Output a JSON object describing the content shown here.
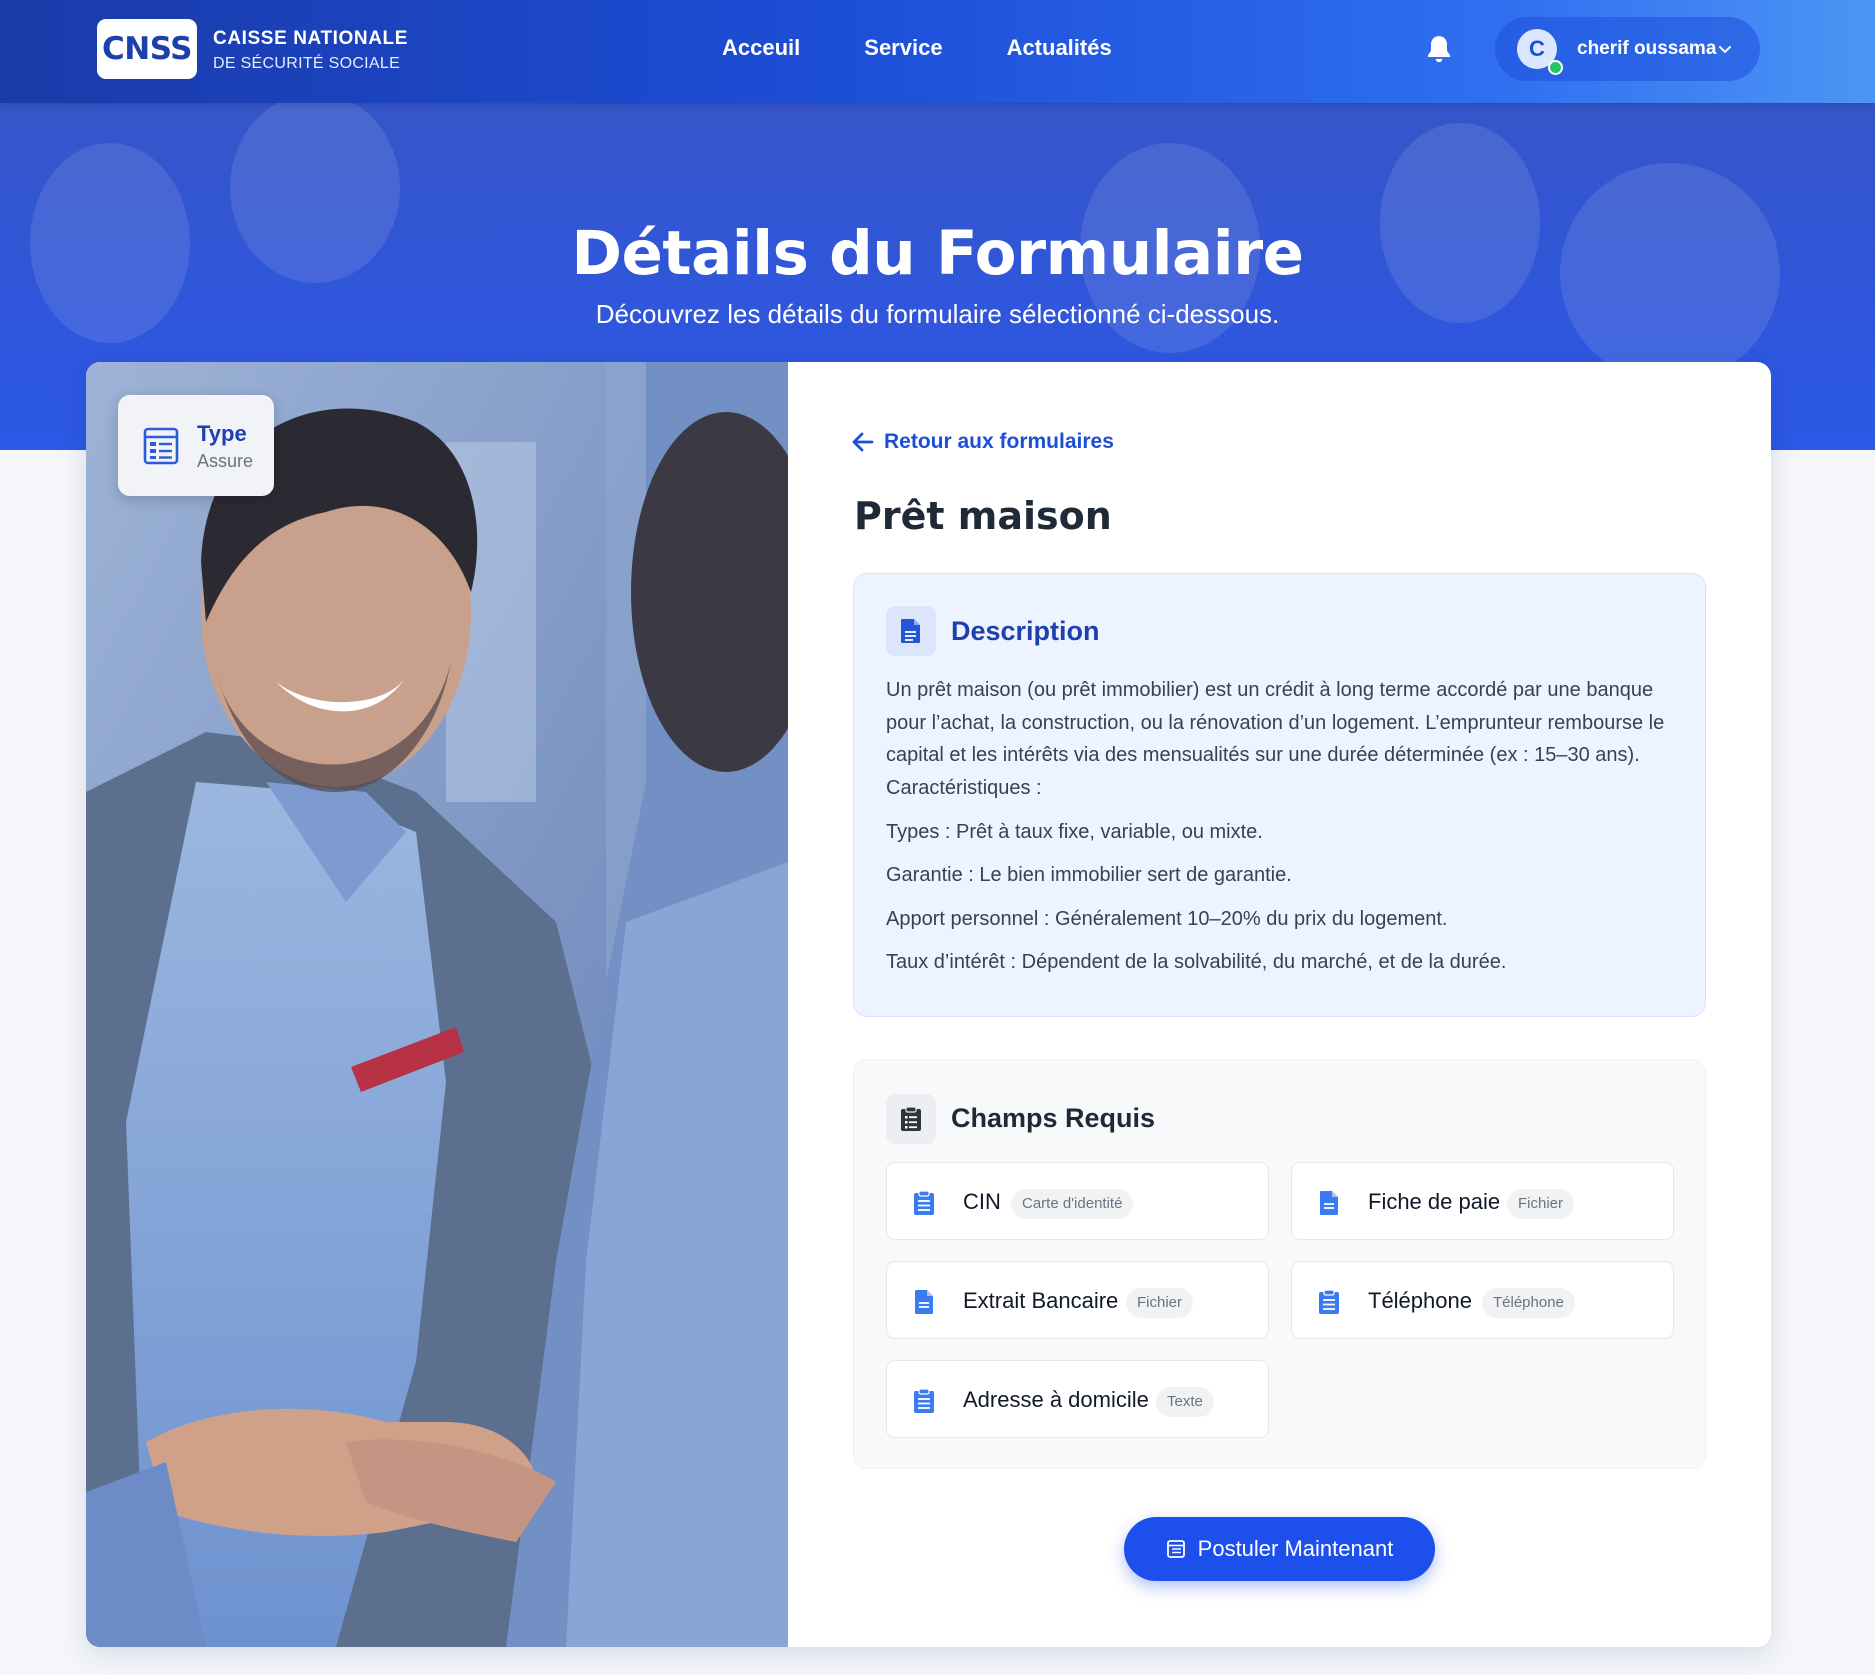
{
  "brand": {
    "logo_text": "CNSS",
    "org_line1": "CAISSE NATIONALE",
    "org_line2": "DE SÉCURITÉ SOCIALE"
  },
  "nav": {
    "links": [
      "Acceuil",
      "Service",
      "Actualités"
    ]
  },
  "user": {
    "initial": "C",
    "name": "cherif oussama",
    "status": "online"
  },
  "hero": {
    "title": "Détails du Formulaire",
    "subtitle": "Découvrez les détails du formulaire sélectionné ci-dessous."
  },
  "type_badge": {
    "label": "Type",
    "value": "Assure"
  },
  "form": {
    "back_label": "Retour aux formulaires",
    "title": "Prêt maison",
    "description": {
      "heading": "Description",
      "paragraphs": [
        "Un prêt maison (ou prêt immobilier) est un crédit à long terme accordé par une banque pour l’achat, la construction, ou la rénovation d’un logement. L’emprunteur rembourse le capital et les intérêts via des mensualités sur une durée déterminée (ex : 15–30 ans). Caractéristiques :",
        "Types : Prêt à taux fixe, variable, ou mixte.",
        "Garantie : Le bien immobilier sert de garantie.",
        "Apport personnel : Généralement 10–20% du prix du logement.",
        "Taux d’intérêt : Dépendent de la solvabilité, du marché, et de la durée."
      ]
    },
    "required_fields": {
      "heading": "Champs Requis",
      "items": [
        {
          "label": "CIN",
          "tag": "Carte d'identité",
          "icon": "clipboard-icon"
        },
        {
          "label": "Fiche de paie",
          "tag": "Fichier",
          "icon": "file-icon"
        },
        {
          "label": "Extrait Bancaire",
          "tag": "Fichier",
          "icon": "file-icon"
        },
        {
          "label": "Téléphone",
          "tag": "Téléphone",
          "icon": "clipboard-icon"
        },
        {
          "label": "Adresse à domicile",
          "tag": "Texte",
          "icon": "clipboard-icon"
        }
      ]
    },
    "apply_label": "Postuler Maintenant"
  },
  "colors": {
    "primary": "#1d4ed8",
    "button": "#1d4fec",
    "online": "#22c55e",
    "description_bg": "#eef4ff"
  }
}
